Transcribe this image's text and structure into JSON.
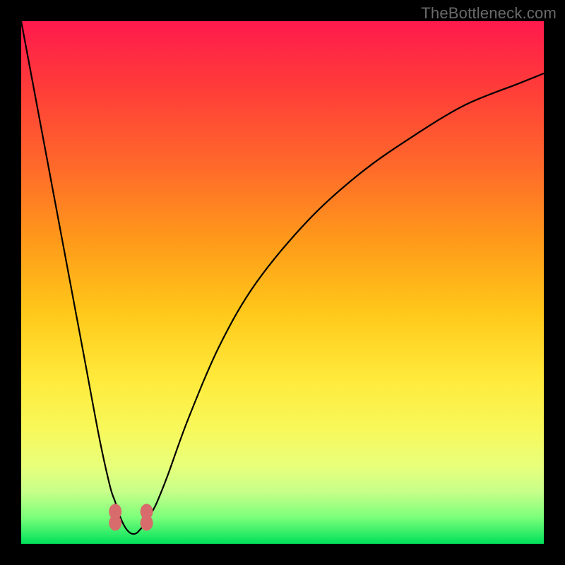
{
  "watermark": "TheBottleneck.com",
  "chart_data": {
    "type": "line",
    "title": "",
    "xlabel": "",
    "ylabel": "",
    "xlim": [
      0,
      100
    ],
    "ylim": [
      0,
      100
    ],
    "series": [
      {
        "name": "bottleneck-curve",
        "x": [
          0,
          3,
          6,
          9,
          12,
          15,
          17,
          18,
          19,
          20,
          21,
          22,
          23,
          24,
          25,
          26,
          28,
          32,
          38,
          45,
          55,
          65,
          75,
          85,
          95,
          100
        ],
        "values": [
          100,
          84,
          68,
          52,
          36,
          20,
          11,
          8,
          5,
          3,
          2,
          2,
          3,
          4,
          6,
          8,
          13,
          24,
          38,
          50,
          62,
          71,
          78,
          84,
          88,
          90
        ]
      }
    ],
    "markers": [
      {
        "name": "valley-marker-left",
        "x": 18,
        "y": 4
      },
      {
        "name": "valley-marker-right",
        "x": 24,
        "y": 4
      }
    ],
    "background_gradient": {
      "stops": [
        {
          "pos": 0,
          "color": "#ff1a4d"
        },
        {
          "pos": 50,
          "color": "#ffc91a"
        },
        {
          "pos": 80,
          "color": "#f8f85a"
        },
        {
          "pos": 100,
          "color": "#00e05a"
        }
      ]
    }
  }
}
